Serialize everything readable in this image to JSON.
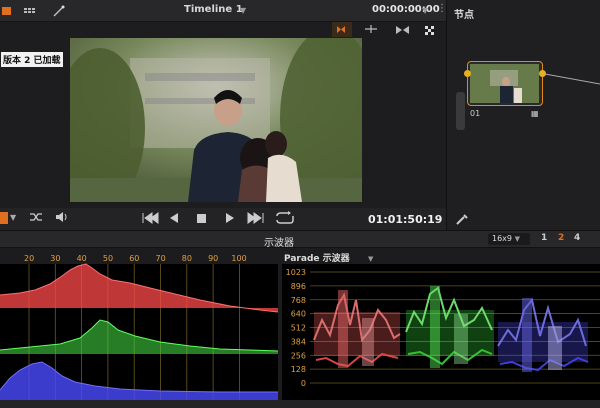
{
  "toolbar": {
    "timeline_label": "Timeline 1",
    "timecode": "00:00:00:00"
  },
  "viewer": {
    "version_label": "版本 2 已加载",
    "playhead_timecode": "01:01:50:19"
  },
  "nodes": {
    "panel_title": "节点",
    "node_label": "01"
  },
  "scopes": {
    "panel_title": "示波器",
    "aspect_select": "16x9",
    "layout_options": [
      "1",
      "2",
      "4"
    ],
    "active_layout": "2",
    "histogram_ticks": [
      "20",
      "30",
      "40",
      "50",
      "60",
      "70",
      "80",
      "90",
      "100"
    ],
    "parade_title": "Parade 示波器",
    "parade_ticks": [
      "1023",
      "896",
      "768",
      "640",
      "512",
      "384",
      "256",
      "128",
      "0"
    ]
  },
  "colors": {
    "accent": "#e08a1a",
    "red_channel": "#ff4040",
    "green_channel": "#40ff40",
    "blue_channel": "#4a4aff"
  }
}
